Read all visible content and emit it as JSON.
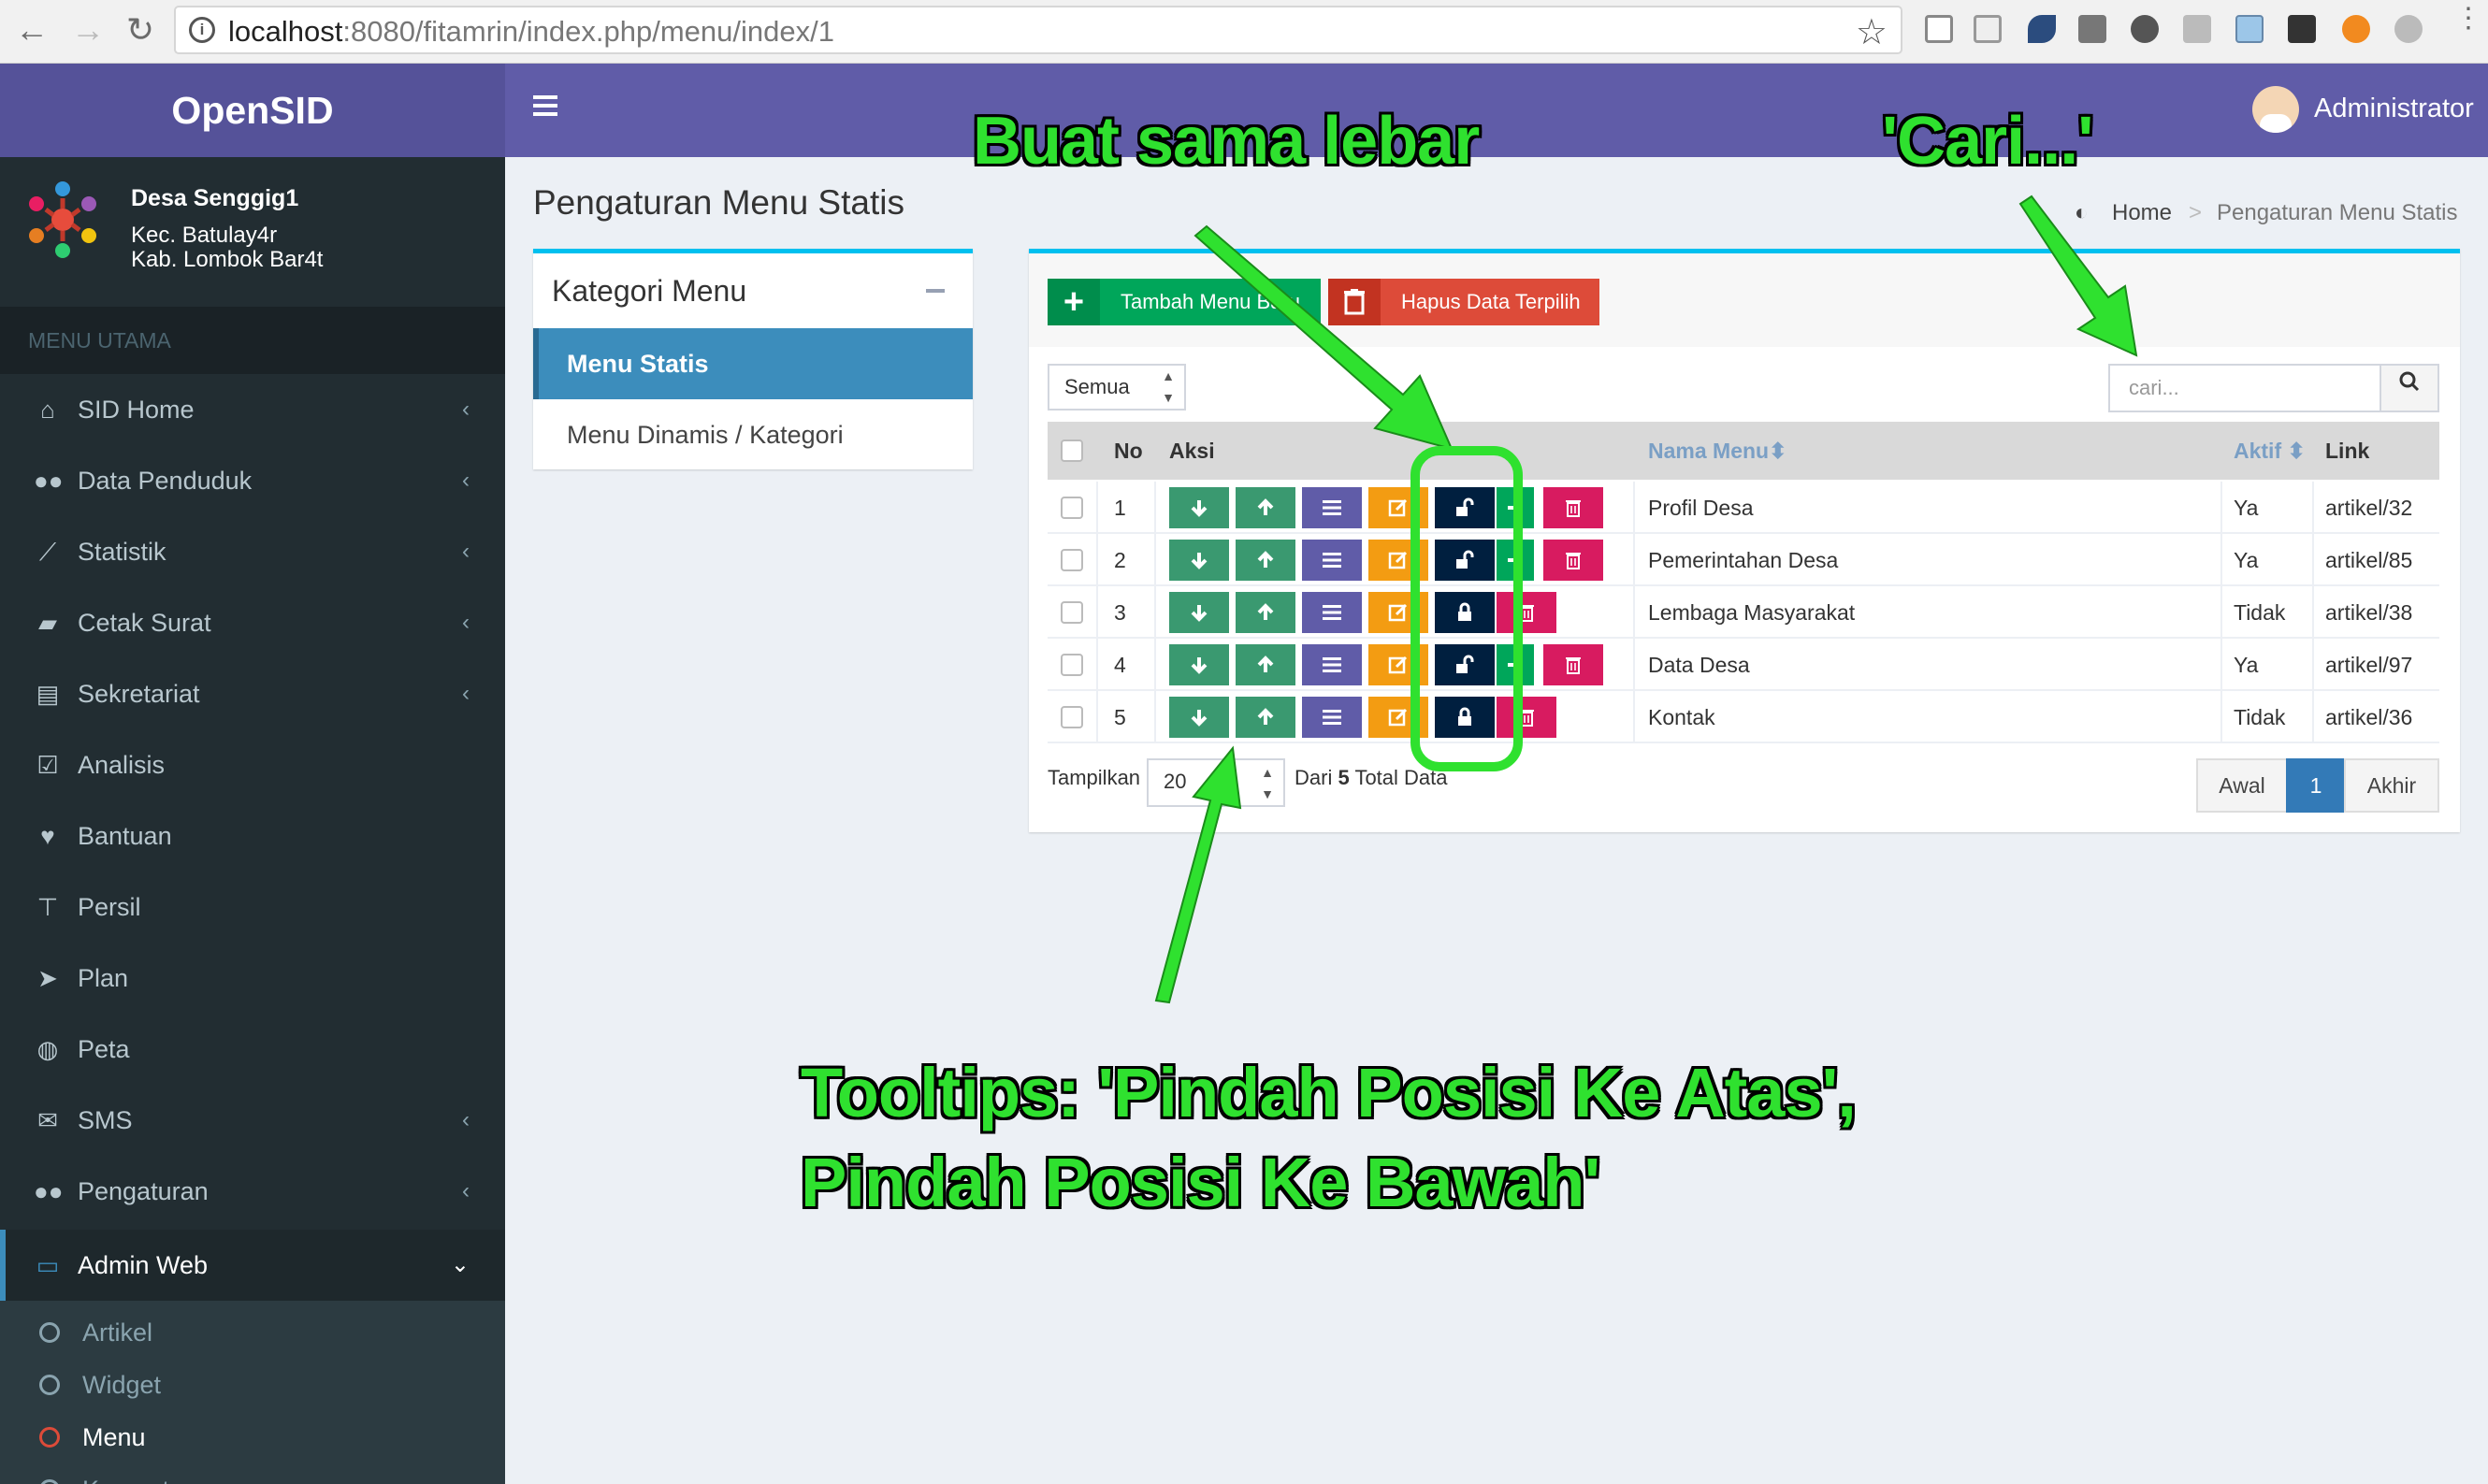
{
  "browser": {
    "url_host": "localhost",
    "url_rest": ":8080/fitamrin/index.php/menu/index/1"
  },
  "app": {
    "brand": "OpenSID",
    "user": "Administrator"
  },
  "profile": {
    "name": "Desa Senggig1",
    "line1": "Kec. Batulay4r",
    "line2": "Kab. Lombok Bar4t"
  },
  "sidebar": {
    "header": "MENU UTAMA",
    "items": [
      {
        "label": "SID Home",
        "icon": "home-icon",
        "chevron": true
      },
      {
        "label": "Data Penduduk",
        "icon": "users-icon",
        "chevron": true
      },
      {
        "label": "Statistik",
        "icon": "line-chart-icon",
        "chevron": true
      },
      {
        "label": "Cetak Surat",
        "icon": "book-icon",
        "chevron": true
      },
      {
        "label": "Sekretariat",
        "icon": "archive-icon",
        "chevron": true
      },
      {
        "label": "Analisis",
        "icon": "check-square-icon",
        "chevron": false
      },
      {
        "label": "Bantuan",
        "icon": "heart-icon",
        "chevron": false
      },
      {
        "label": "Persil",
        "icon": "signpost-icon",
        "chevron": false
      },
      {
        "label": "Plan",
        "icon": "location-arrow-icon",
        "chevron": false
      },
      {
        "label": "Peta",
        "icon": "globe-icon",
        "chevron": false
      },
      {
        "label": "SMS",
        "icon": "envelope-icon",
        "chevron": true
      },
      {
        "label": "Pengaturan",
        "icon": "users-icon",
        "chevron": true
      },
      {
        "label": "Admin Web",
        "icon": "desktop-icon",
        "chevron": true
      }
    ],
    "sub_items": [
      "Artikel",
      "Widget",
      "Menu",
      "Komentar"
    ]
  },
  "page": {
    "title": "Pengaturan Menu Statis",
    "breadcrumb_home": "Home",
    "breadcrumb_sep": ">",
    "breadcrumb_current": "Pengaturan Menu Statis"
  },
  "kategori": {
    "title": "Kategori Menu",
    "items": [
      "Menu Statis",
      "Menu Dinamis / Kategori"
    ]
  },
  "toolbar": {
    "add_label": "Tambah Menu Baru",
    "delete_label": "Hapus Data Terpilih",
    "filter_value": "Semua",
    "search_placeholder": "cari..."
  },
  "table": {
    "headers": {
      "no": "No",
      "aksi": "Aksi",
      "nama": "Nama Menu",
      "aktif": "Aktif",
      "link": "Link"
    },
    "rows": [
      {
        "no": "1",
        "nama": "Profil Desa",
        "aktif": "Ya",
        "link": "artikel/32",
        "lock": "unlocked",
        "has_add": true
      },
      {
        "no": "2",
        "nama": "Pemerintahan Desa",
        "aktif": "Ya",
        "link": "artikel/85",
        "lock": "unlocked",
        "has_add": true
      },
      {
        "no": "3",
        "nama": "Lembaga Masyarakat",
        "aktif": "Tidak",
        "link": "artikel/38",
        "lock": "locked",
        "has_add": false
      },
      {
        "no": "4",
        "nama": "Data Desa",
        "aktif": "Ya",
        "link": "artikel/97",
        "lock": "unlocked",
        "has_add": true
      },
      {
        "no": "5",
        "nama": "Kontak",
        "aktif": "Tidak",
        "link": "artikel/36",
        "lock": "locked",
        "has_add": false
      }
    ]
  },
  "footer": {
    "show_label": "Tampilkan",
    "page_size": "20",
    "from_label": "Dari",
    "total": "5",
    "total_label": "Total Data",
    "pages": [
      "Awal",
      "1",
      "Akhir"
    ]
  },
  "annotations": {
    "top_note": "Buat sama lebar",
    "search_note": "'Cari...'",
    "tooltip_line1": "Tooltips:  'Pindah Posisi Ke Atas',",
    "tooltip_line2": "Pindah Posisi Ke Bawah'"
  },
  "colors": {
    "header": "#605ca8",
    "sidebar": "#222d32",
    "move_btn": "#3a9970",
    "list_btn": "#605ca8",
    "edit_btn": "#f39c12",
    "lock_btn": "#001f3f",
    "add_btn": "#00a65a",
    "delete_btn": "#d81b60",
    "annotation": "#2fe12f"
  }
}
